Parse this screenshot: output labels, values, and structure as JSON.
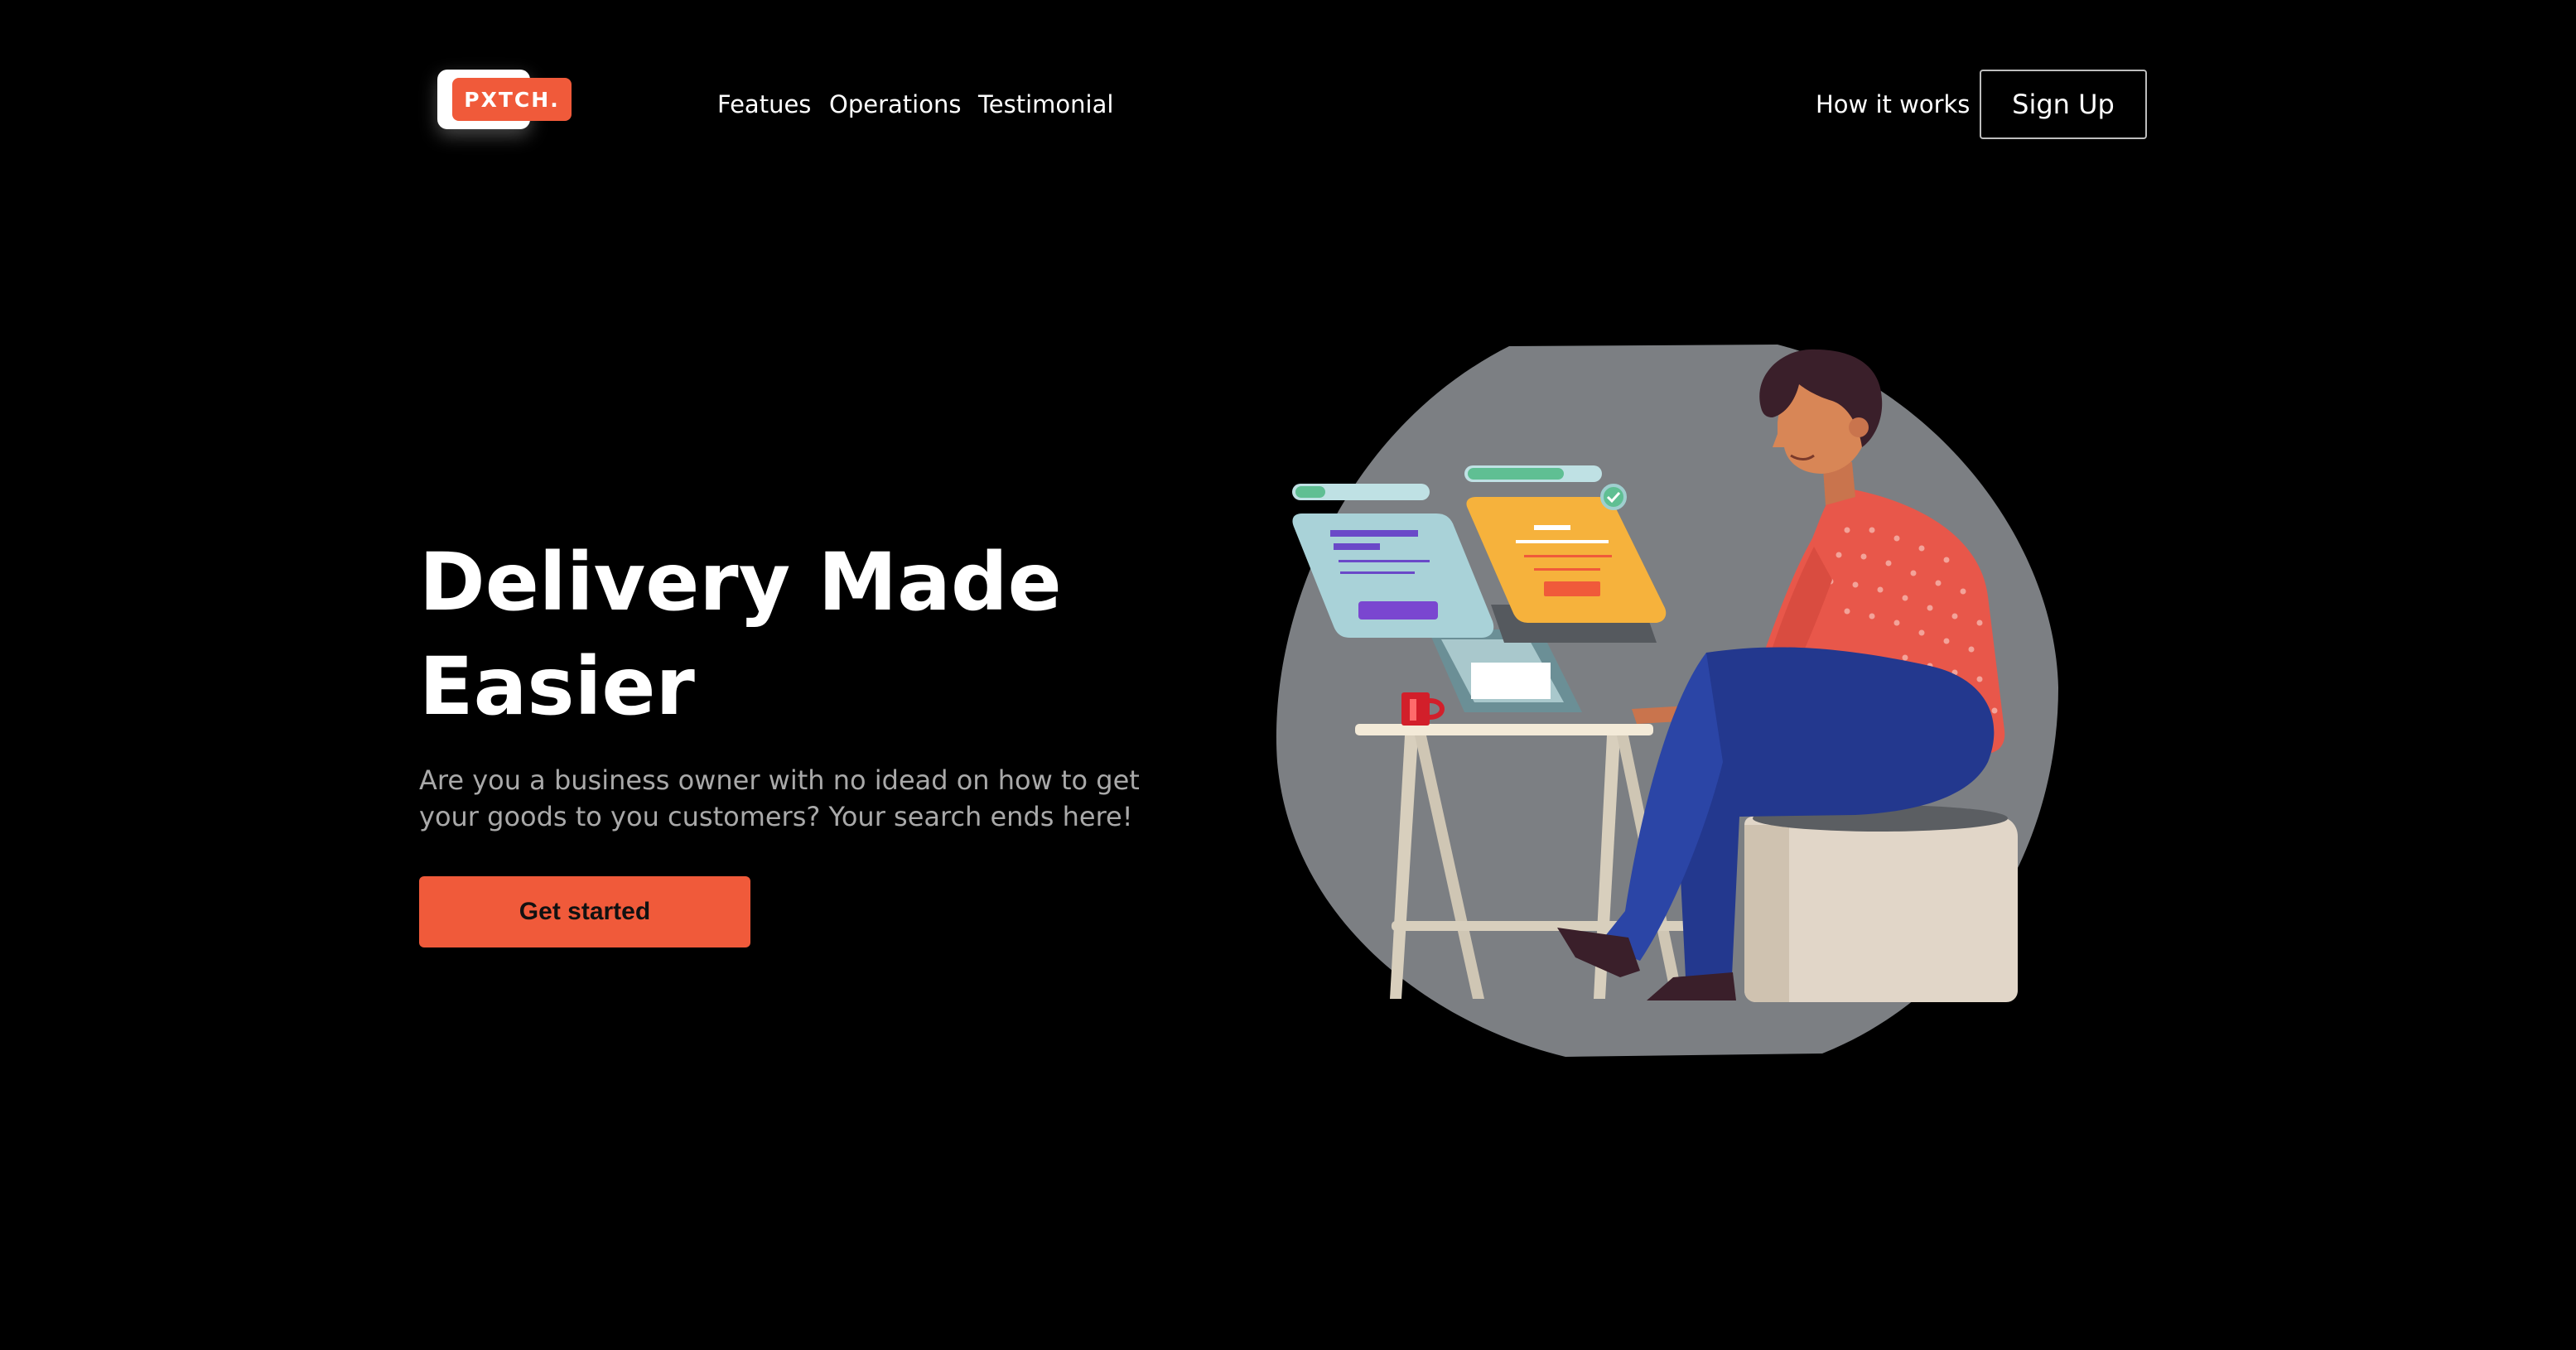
{
  "brand": {
    "logo_text": "PXTCH.",
    "accent_color": "#f05a3a"
  },
  "nav": {
    "links": [
      {
        "label": "Featues"
      },
      {
        "label": "Operations"
      },
      {
        "label": "Testimonial"
      }
    ],
    "how_it_works": "How it works",
    "sign_up": "Sign Up"
  },
  "hero": {
    "title": "Delivery Made Easier",
    "description": "Are you a business owner with no idead on how to get your goods to you customers? Your search ends here!",
    "cta": "Get started"
  },
  "illustration": {
    "icon": "person-at-desk-illustration",
    "background_color": "#7c7f83"
  }
}
